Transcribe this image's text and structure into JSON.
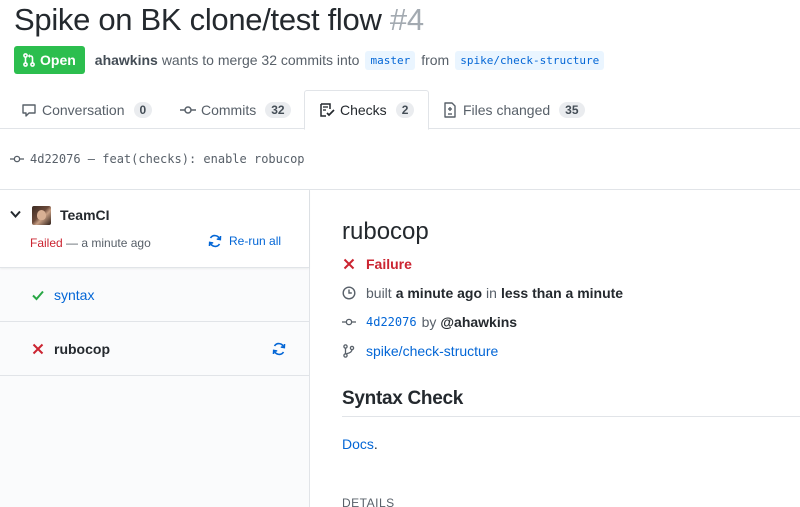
{
  "pr": {
    "title": "Spike on BK clone/test flow",
    "number": "#4",
    "state": "Open",
    "author": "ahawkins",
    "merge_text": "wants to merge 32 commits into",
    "base_branch": "master",
    "from_text": "from",
    "head_branch": "spike/check-structure"
  },
  "tabs": [
    {
      "label": "Conversation",
      "count": "0",
      "icon": "comment-icon"
    },
    {
      "label": "Commits",
      "count": "32",
      "icon": "commit-icon"
    },
    {
      "label": "Checks",
      "count": "2",
      "icon": "checklist-icon"
    },
    {
      "label": "Files changed",
      "count": "35",
      "icon": "file-diff-icon"
    }
  ],
  "commit": {
    "text": "4d22076 — feat(checks): enable robucop"
  },
  "suite": {
    "app_name": "TeamCI",
    "status": "Failed",
    "time": "— a minute ago",
    "rerun_label": "Re-run all"
  },
  "runs": [
    {
      "name": "syntax",
      "status": "success"
    },
    {
      "name": "rubocop",
      "status": "failure"
    }
  ],
  "detail": {
    "title": "rubocop",
    "conclusion": "Failure",
    "built_prefix": "built",
    "built_time": "a minute ago",
    "built_mid": "in",
    "built_duration": "less than a minute",
    "sha": "4d22076",
    "by_text": "by",
    "user": "@ahawkins",
    "branch": "spike/check-structure",
    "section_title": "Syntax Check",
    "docs_link": "Docs",
    "docs_suffix": ".",
    "details_label": "DETAILS"
  },
  "colors": {
    "open_green": "#2cbe4e",
    "link_blue": "#0366d6",
    "failure_red": "#cb2431",
    "success_green": "#28a745"
  }
}
